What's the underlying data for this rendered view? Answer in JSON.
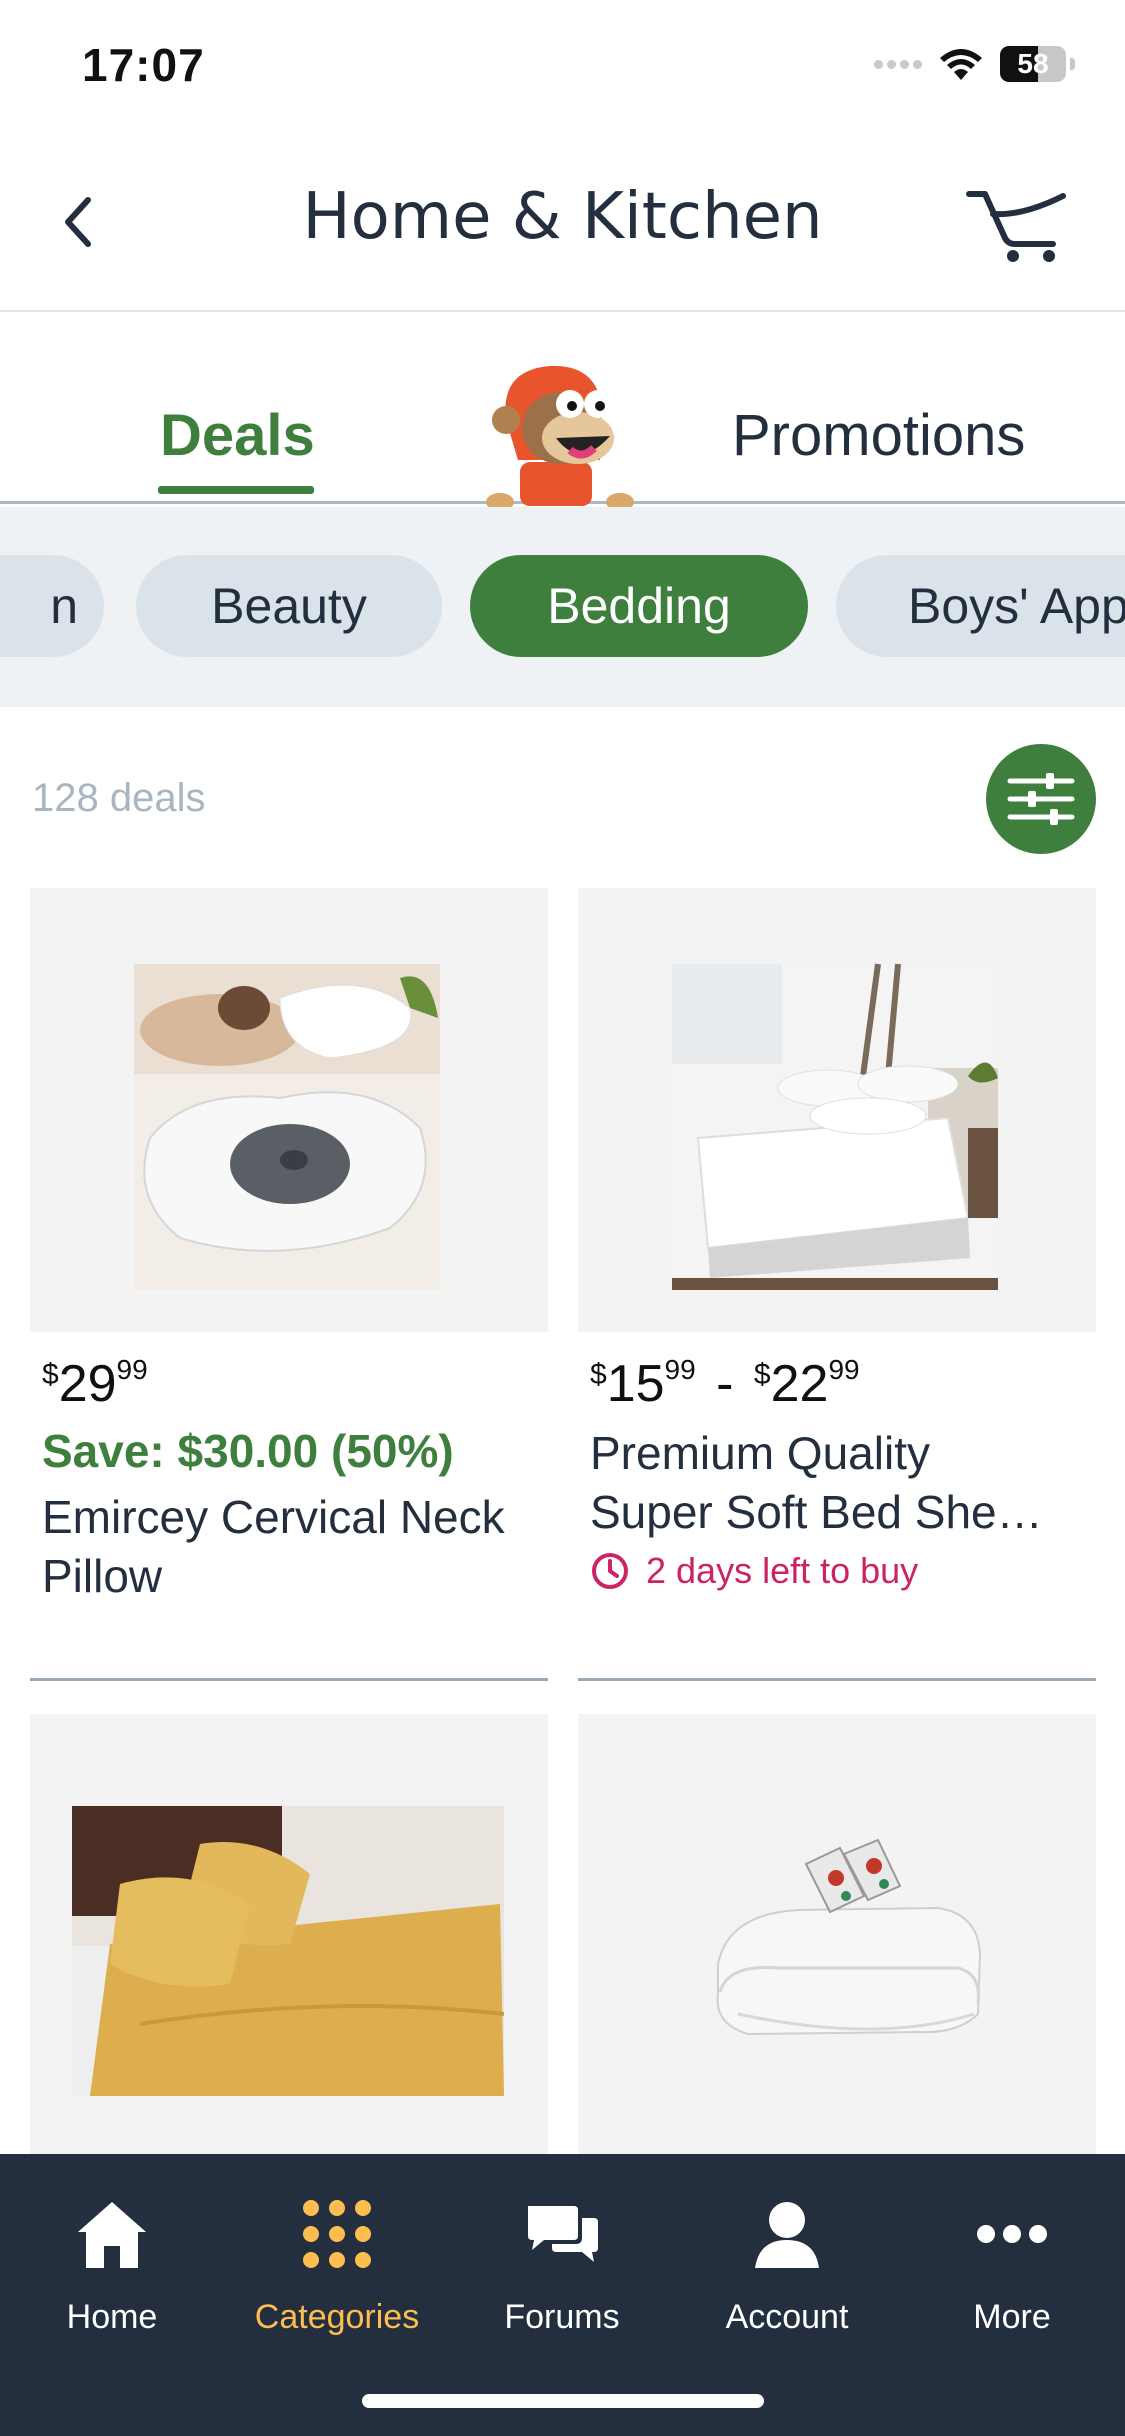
{
  "status_bar": {
    "time": "17:07",
    "battery": "58",
    "battery_level": 0.58
  },
  "header": {
    "title": "Home & Kitchen"
  },
  "tabs": [
    {
      "label": "Deals",
      "active": true
    },
    {
      "label": "Promotions",
      "active": false
    }
  ],
  "categories": [
    {
      "label": "n",
      "active": false
    },
    {
      "label": "Beauty",
      "active": false
    },
    {
      "label": "Bedding",
      "active": true
    },
    {
      "label": "Boys' App",
      "active": false
    }
  ],
  "deal_count": "128 deals",
  "products": [
    {
      "price_currency": "$",
      "price_whole": "29",
      "price_fraction": "99",
      "save": "Save: $30.00 (50%)",
      "title_line1": "Emircey Cervical Neck",
      "title_line2": "Pillow"
    },
    {
      "price_currency": "$",
      "price_whole": "15",
      "price_fraction": "99",
      "price_sep": "-",
      "price2_currency": "$",
      "price2_whole": "22",
      "price2_fraction": "99",
      "title_line1": "Premium Quality",
      "title_line2": "Super Soft Bed She…",
      "timer": "2 days left to buy"
    },
    {
      "image": "mustard-bed-sheets"
    },
    {
      "image": "heated-mattress-pad"
    }
  ],
  "bottom_nav": [
    {
      "label": "Home",
      "icon": "home-icon",
      "active": false
    },
    {
      "label": "Categories",
      "icon": "grid-icon",
      "active": true
    },
    {
      "label": "Forums",
      "icon": "chat-icon",
      "active": false
    },
    {
      "label": "Account",
      "icon": "person-icon",
      "active": false
    },
    {
      "label": "More",
      "icon": "more-icon",
      "active": false
    }
  ],
  "colors": {
    "brand_green": "#3e7f3e",
    "nav_bg": "#232f3e",
    "nav_active": "#febd4f",
    "timer_pink": "#cc2266"
  }
}
